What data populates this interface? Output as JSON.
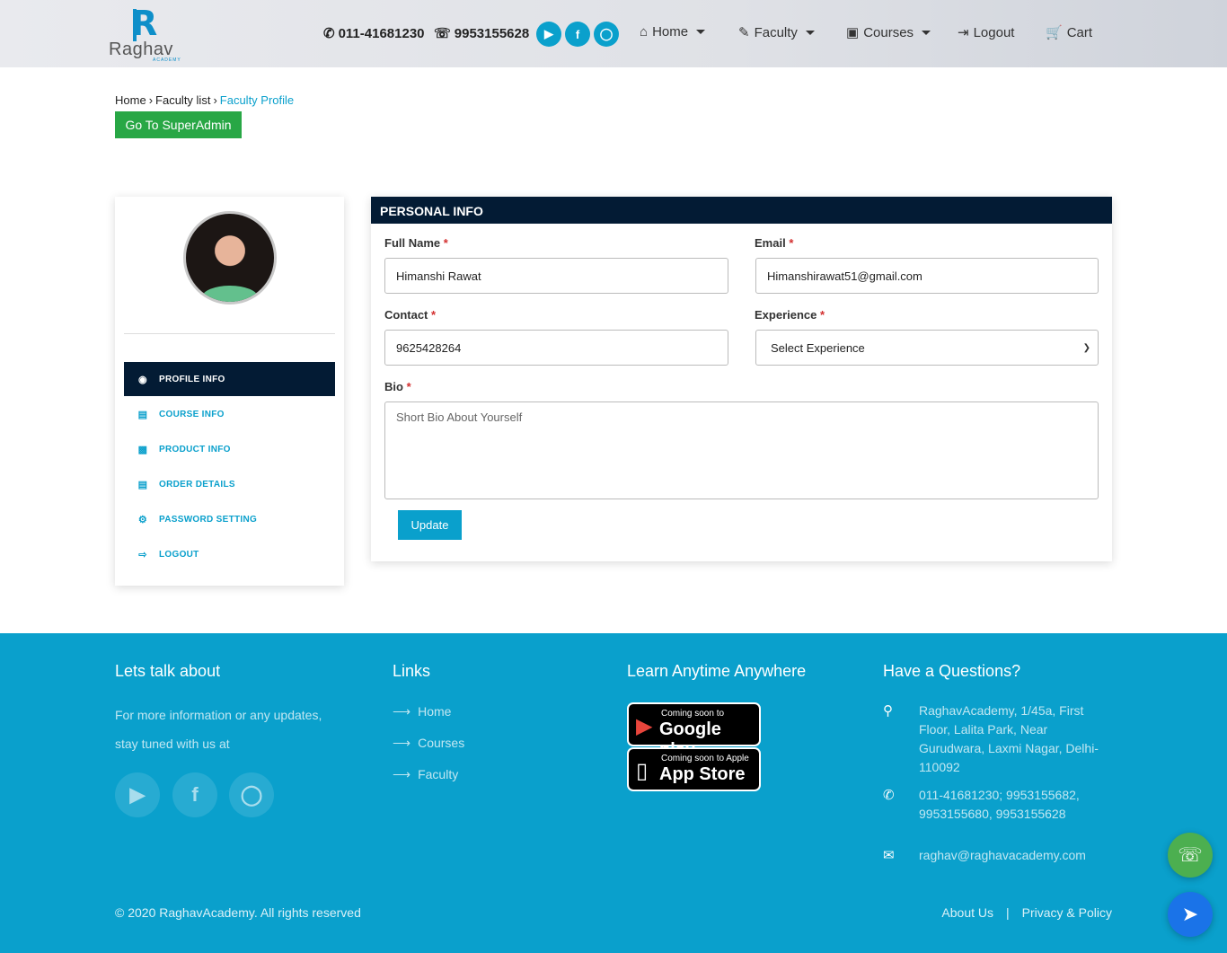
{
  "header": {
    "logo_text": "Raghav",
    "logo_sub": "ACADEMY",
    "phone": "011-41681230",
    "whatsapp": "9953155628",
    "social": [
      "youtube-icon",
      "facebook-icon",
      "instagram-icon"
    ],
    "nav": {
      "home": "Home",
      "faculty": "Faculty",
      "courses": "Courses",
      "logout": "Logout",
      "cart": "Cart"
    }
  },
  "breadcrumb": {
    "home": "Home",
    "faculty_list": "Faculty list",
    "current": "Faculty Profile"
  },
  "superadmin_button": "Go To SuperAdmin",
  "sidebar": {
    "items": [
      {
        "label": "PROFILE INFO",
        "icon": "user-circle-icon",
        "active": true
      },
      {
        "label": "COURSE INFO",
        "icon": "document-icon",
        "active": false
      },
      {
        "label": "PRODUCT INFO",
        "icon": "book-icon",
        "active": false
      },
      {
        "label": "ORDER DETAILS",
        "icon": "document-icon",
        "active": false
      },
      {
        "label": "PASSWORD SETTING",
        "icon": "gear-icon",
        "active": false
      },
      {
        "label": "LOGOUT",
        "icon": "sign-out-icon",
        "active": false
      }
    ]
  },
  "form": {
    "title": "PERSONAL INFO",
    "full_name": {
      "label": "Full Name",
      "value": "Himanshi Rawat"
    },
    "email": {
      "label": "Email",
      "value": "Himanshirawat51@gmail.com"
    },
    "contact": {
      "label": "Contact",
      "value": "9625428264"
    },
    "experience": {
      "label": "Experience",
      "value": "Select Experience"
    },
    "bio": {
      "label": "Bio",
      "placeholder": "Short Bio About Yourself"
    },
    "required_mark": "*",
    "update_button": "Update"
  },
  "footer": {
    "col1": {
      "title": "Lets talk about",
      "line1": "For more information or any updates,",
      "line2": "stay tuned with us at"
    },
    "col2": {
      "title": "Links",
      "links": [
        "Home",
        "Courses",
        "Faculty"
      ]
    },
    "col3": {
      "title": "Learn Anytime Anywhere",
      "google": {
        "small": "Coming soon to",
        "big": "Google play"
      },
      "apple": {
        "small": "Coming soon to Apple",
        "big": "App Store"
      }
    },
    "col4": {
      "title": "Have a Questions?",
      "address": "RaghavAcademy, 1/45a, First Floor, Lalita Park, Near Gurudwara, Laxmi Nagar, Delhi-110092",
      "phones": "011-41681230; 9953155682, 9953155680, 9953155628",
      "email": "raghav@raghavacademy.com"
    },
    "copyright": "© 2020 RaghavAcademy. All rights reserved",
    "about": "About Us",
    "separator": "|",
    "privacy": "Privacy & Policy"
  },
  "colors": {
    "accent": "#0aa0cc",
    "navy": "#031b34",
    "green": "#28a745"
  }
}
